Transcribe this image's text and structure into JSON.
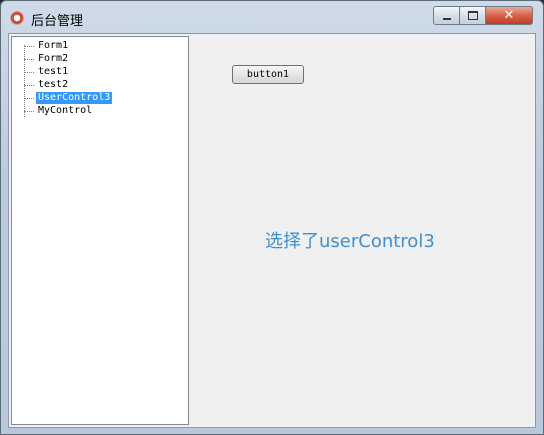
{
  "window": {
    "title": "后台管理",
    "app_icon": "app-icon",
    "controls": {
      "minimize_icon": "minimize-icon",
      "maximize_icon": "maximize-icon",
      "close_label": "✕"
    }
  },
  "tree": {
    "items": [
      {
        "label": "Form1",
        "selected": false
      },
      {
        "label": "Form2",
        "selected": false
      },
      {
        "label": "test1",
        "selected": false
      },
      {
        "label": "test2",
        "selected": false
      },
      {
        "label": "UserControl3",
        "selected": true
      },
      {
        "label": "MyControl",
        "selected": false
      }
    ]
  },
  "panel": {
    "button_label": "button1",
    "status_text": "选择了userControl3",
    "status_color": "#3f8fd0"
  },
  "colors": {
    "selection": "#3399ff",
    "close_button": "#c43c22"
  }
}
